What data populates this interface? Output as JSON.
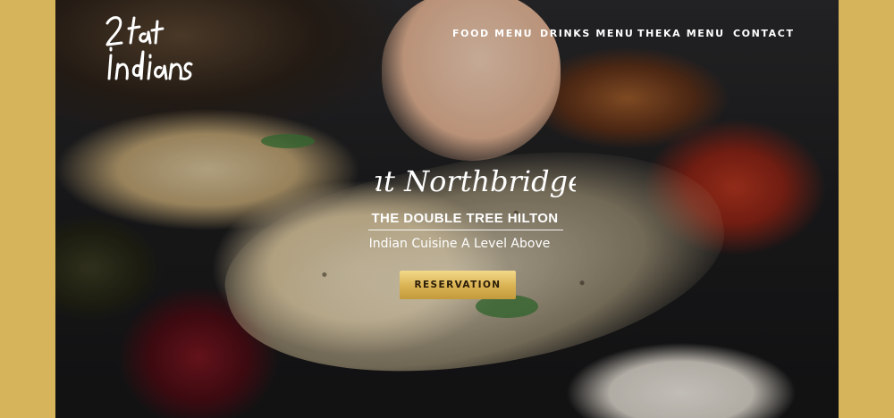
{
  "brand": {
    "logo_text": "2 Fat Indians",
    "accent_color": "#d6b45c"
  },
  "nav": {
    "items": [
      {
        "label": "FOOD MENU"
      },
      {
        "label": "DRINKS MENU"
      },
      {
        "label": "THEKA MENU"
      },
      {
        "label": "CONTACT"
      }
    ]
  },
  "hero": {
    "script_line": "at Northbridge",
    "venue": "THE DOUBLE TREE HILTON",
    "tagline": "Indian Cuisine A Level Above",
    "cta_label": "RESERVATION"
  }
}
